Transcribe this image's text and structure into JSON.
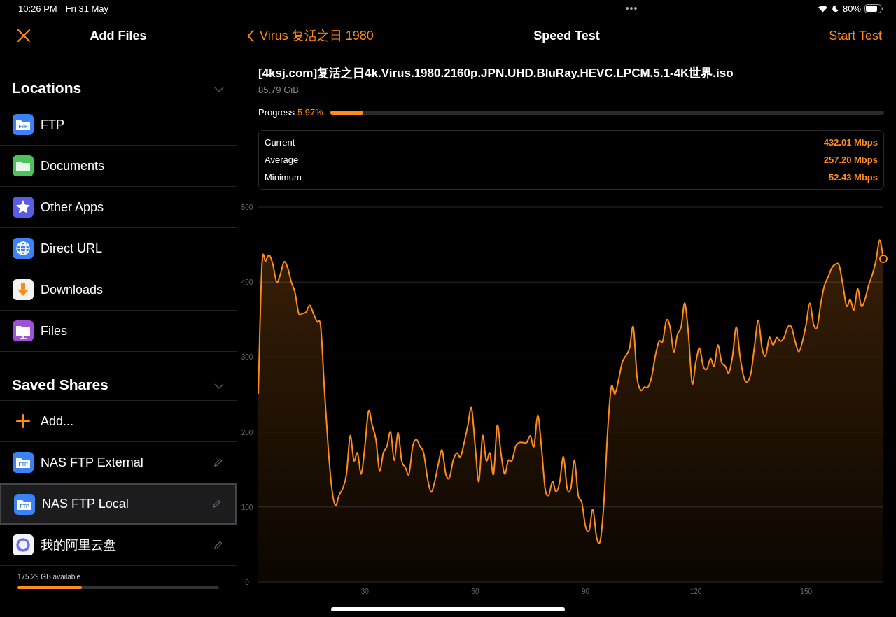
{
  "status_bar": {
    "time": "10:26 PM",
    "date": "Fri 31 May",
    "dots": "•••",
    "battery": "80%"
  },
  "sidebar": {
    "title": "Add Files",
    "sections": [
      {
        "title": "Locations",
        "expanded": true,
        "items": [
          {
            "kind": "ftp",
            "badge": "FTP",
            "label": "FTP",
            "selected": false
          },
          {
            "kind": "folder",
            "label": "Documents",
            "selected": false
          },
          {
            "kind": "star",
            "label": "Other Apps",
            "selected": false
          },
          {
            "kind": "globe",
            "label": "Direct URL",
            "selected": false
          },
          {
            "kind": "download",
            "label": "Downloads",
            "selected": false
          },
          {
            "kind": "files",
            "label": "Files",
            "selected": false
          }
        ]
      },
      {
        "title": "Saved Shares",
        "expanded": true,
        "items": [
          {
            "kind": "add",
            "label": "Add...",
            "selected": false
          },
          {
            "kind": "ftp",
            "badge": "FTP",
            "label": "NAS FTP External",
            "selected": false,
            "editable": true
          },
          {
            "kind": "ftp",
            "badge": "FTP",
            "label": "NAS FTP Local",
            "selected": true,
            "editable": true
          },
          {
            "kind": "cloud",
            "label": "我的阿里云盘",
            "selected": false,
            "editable": true
          }
        ]
      }
    ],
    "storage": {
      "label": "175.29 GB available",
      "level": 0.32
    }
  },
  "main": {
    "back": "Virus 复活之日 1980",
    "title": "Speed Test",
    "action": "Start Test",
    "file": {
      "name": "[4ksj.com]复活之日4k.Virus.1980.2160p.JPN.UHD.BluRay.HEVC.LPCM.5.1-4K世界.iso",
      "size": "85.79 GiB"
    },
    "progress": {
      "label": "Progress",
      "value": "5.97%",
      "level": 0.0597
    },
    "stats": [
      {
        "label": "Current",
        "value": "432.01 Mbps"
      },
      {
        "label": "Average",
        "value": "257.20 Mbps"
      },
      {
        "label": "Minimum",
        "value": "52.43 Mbps"
      }
    ],
    "chart_data": {
      "type": "area",
      "xlim": [
        1,
        171
      ],
      "ylim": [
        0,
        500
      ],
      "xticks": [
        30,
        60,
        90,
        120,
        150
      ],
      "yticks": [
        0,
        100,
        200,
        300,
        400,
        500
      ],
      "grid": true,
      "x": [
        1,
        2,
        3,
        4,
        5,
        6,
        7,
        8,
        9,
        10,
        11,
        12,
        13,
        14,
        15,
        16,
        17,
        18,
        19,
        20,
        21,
        22,
        23,
        24,
        25,
        26,
        27,
        28,
        29,
        30,
        31,
        32,
        33,
        34,
        35,
        36,
        37,
        38,
        39,
        40,
        41,
        42,
        43,
        44,
        45,
        46,
        47,
        48,
        49,
        50,
        51,
        52,
        53,
        54,
        55,
        56,
        57,
        58,
        59,
        60,
        61,
        62,
        63,
        64,
        65,
        66,
        67,
        68,
        69,
        70,
        71,
        72,
        73,
        74,
        75,
        76,
        77,
        78,
        79,
        80,
        81,
        82,
        83,
        84,
        85,
        86,
        87,
        88,
        89,
        90,
        91,
        92,
        93,
        94,
        95,
        96,
        97,
        98,
        99,
        100,
        101,
        102,
        103,
        104,
        105,
        106,
        107,
        108,
        109,
        110,
        111,
        112,
        113,
        114,
        115,
        116,
        117,
        118,
        119,
        120,
        121,
        122,
        123,
        124,
        125,
        126,
        127,
        128,
        129,
        130,
        131,
        132,
        133,
        134,
        135,
        136,
        137,
        138,
        139,
        140,
        141,
        142,
        143,
        144,
        145,
        146,
        147,
        148,
        149,
        150,
        151,
        152,
        153,
        154,
        155,
        156,
        157,
        158,
        159,
        160,
        161,
        162,
        163,
        164,
        165,
        166,
        167,
        168,
        169,
        170,
        171
      ],
      "series": [
        {
          "color": "#ff8c1a",
          "values": [
            251,
            423,
            428,
            436,
            423,
            400,
            410,
            427,
            419,
            400,
            386,
            358,
            358,
            360,
            369,
            358,
            347,
            340,
            256,
            181,
            125,
            102,
            116,
            125,
            144,
            195,
            162,
            172,
            144,
            181,
            228,
            209,
            190,
            148,
            172,
            181,
            200,
            162,
            200,
            162,
            153,
            144,
            181,
            190,
            181,
            172,
            139,
            120,
            134,
            158,
            176,
            144,
            139,
            162,
            172,
            167,
            186,
            209,
            232,
            181,
            134,
            195,
            162,
            172,
            144,
            209,
            172,
            144,
            162,
            162,
            181,
            186,
            186,
            186,
            195,
            181,
            223,
            181,
            125,
            116,
            134,
            120,
            134,
            167,
            125,
            125,
            162,
            116,
            106,
            74,
            69,
            97,
            60,
            55,
            106,
            200,
            260,
            251,
            270,
            293,
            302,
            312,
            340,
            274,
            256,
            260,
            260,
            274,
            302,
            321,
            321,
            349,
            340,
            307,
            330,
            340,
            372,
            330,
            265,
            293,
            312,
            288,
            284,
            298,
            288,
            316,
            293,
            288,
            279,
            302,
            340,
            302,
            274,
            267,
            279,
            316,
            349,
            312,
            302,
            326,
            316,
            326,
            321,
            326,
            340,
            340,
            321,
            307,
            321,
            344,
            372,
            344,
            340,
            372,
            396,
            407,
            419,
            424,
            422,
            396,
            368,
            377,
            363,
            391,
            368,
            377,
            396,
            410,
            429,
            456,
            431
          ]
        }
      ]
    }
  }
}
